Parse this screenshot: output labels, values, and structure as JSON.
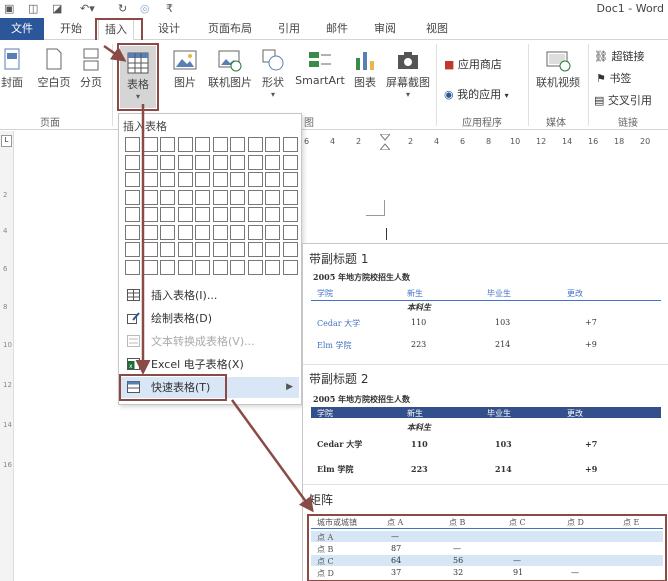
{
  "titlebar": {
    "doc_title": "Doc1 - Word"
  },
  "tabs": [
    {
      "label": "文件"
    },
    {
      "label": "开始"
    },
    {
      "label": "插入"
    },
    {
      "label": "设计"
    },
    {
      "label": "页面布局"
    },
    {
      "label": "引用"
    },
    {
      "label": "邮件"
    },
    {
      "label": "审阅"
    },
    {
      "label": "视图"
    }
  ],
  "ribbon": {
    "pages_group": {
      "label": "页面",
      "cover": "封面",
      "blank": "空白页",
      "break": "分页"
    },
    "table_btn": "表格",
    "pictures": "图片",
    "online_pictures": "联机图片",
    "shapes": "形状",
    "smartart": "SmartArt",
    "chart": "图表",
    "screenshot": "屏幕截图",
    "illustrations_label": "图",
    "apps": {
      "store": "应用商店",
      "my_apps": "我的应用",
      "label": "应用程序"
    },
    "media": {
      "online_video": "联机视频",
      "label": "媒体"
    },
    "links": {
      "hyperlink": "超链接",
      "bookmark": "书签",
      "cross_ref": "交叉引用",
      "label": "链接"
    }
  },
  "ruler": {
    "left_numbers": [
      "2",
      "4",
      "6",
      "8",
      "10",
      "12",
      "14",
      "16"
    ],
    "top_numbers": [
      "6",
      "4",
      "2",
      "2",
      "4",
      "6",
      "8",
      "10",
      "12",
      "14",
      "16",
      "18",
      "20",
      "22"
    ]
  },
  "dropdown": {
    "header": "插入表格",
    "items": [
      {
        "label": "插入表格(I)..."
      },
      {
        "label": "绘制表格(D)"
      },
      {
        "label": "文本转换成表格(V)..."
      },
      {
        "label": "Excel 电子表格(X)"
      },
      {
        "label": "快速表格(T)"
      }
    ]
  },
  "quick_tables": {
    "t1": {
      "title": "带副标题 1",
      "caption": "2005 年地方院校招生人数",
      "headers": [
        "学院",
        "新生",
        "毕业生",
        "更改"
      ],
      "subheader": "本科生",
      "rows": [
        [
          "Cedar 大学",
          "110",
          "103",
          "+7"
        ],
        [
          "Elm 学院",
          "223",
          "214",
          "+9"
        ]
      ]
    },
    "t2": {
      "title": "带副标题 2",
      "caption": "2005 年地方院校招生人数",
      "headers": [
        "学院",
        "新生",
        "毕业生",
        "更改"
      ],
      "subheader": "本科生",
      "rows": [
        [
          "Cedar 大学",
          "110",
          "103",
          "+7"
        ],
        [
          "Elm 学院",
          "223",
          "214",
          "+9"
        ]
      ]
    },
    "t3": {
      "title": "矩阵",
      "headers": [
        "城市或城镇",
        "点 A",
        "点 B",
        "点 C",
        "点 D",
        "点 E"
      ],
      "rows": [
        [
          "点 A",
          "—",
          "",
          "",
          "",
          ""
        ],
        [
          "点 B",
          "87",
          "—",
          "",
          "",
          ""
        ],
        [
          "点 C",
          "64",
          "56",
          "—",
          "",
          ""
        ],
        [
          "点 D",
          "37",
          "32",
          "91",
          "—",
          ""
        ]
      ]
    }
  },
  "colors": {
    "file_tab": "#2b579a",
    "highlight": "#8a4b46",
    "band": "#34508c",
    "hover": "#d8e6f5"
  }
}
